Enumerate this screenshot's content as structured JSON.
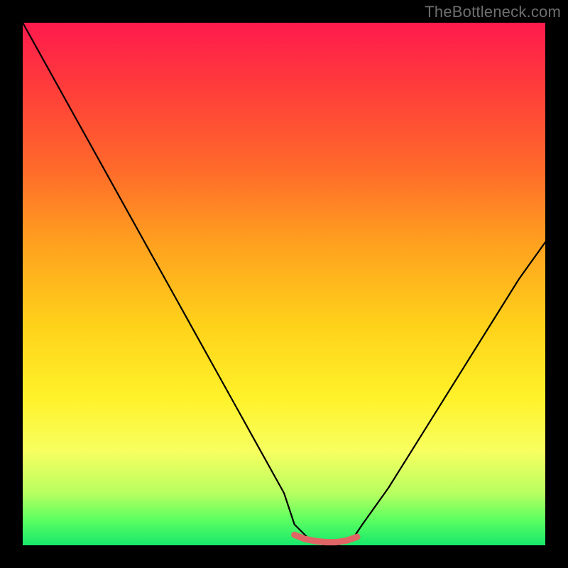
{
  "watermark": "TheBottleneck.com",
  "chart_data": {
    "type": "line",
    "title": "",
    "xlabel": "",
    "ylabel": "",
    "xlim": [
      0,
      100
    ],
    "ylim": [
      0,
      100
    ],
    "series": [
      {
        "name": "bottleneck-curve",
        "x": [
          0,
          5,
          10,
          15,
          20,
          25,
          30,
          35,
          40,
          45,
          50,
          52,
          55,
          58,
          60,
          63,
          65,
          70,
          75,
          80,
          85,
          90,
          95,
          100
        ],
        "values": [
          100,
          91,
          82,
          73,
          64,
          55,
          46,
          37,
          28,
          19,
          10,
          4,
          1,
          0,
          0,
          1,
          4,
          11,
          19,
          27,
          35,
          43,
          51,
          58
        ]
      },
      {
        "name": "flat-bottom-highlight",
        "x": [
          52,
          54,
          56,
          58,
          60,
          62,
          64
        ],
        "values": [
          2,
          1.2,
          0.8,
          0.6,
          0.6,
          0.9,
          1.6
        ]
      }
    ],
    "colors": {
      "curve": "#000000",
      "highlight": "#e06666",
      "gradient_top": "#ff1a4d",
      "gradient_mid": "#ffd21a",
      "gradient_bottom": "#17e86b",
      "frame": "#000000"
    }
  }
}
